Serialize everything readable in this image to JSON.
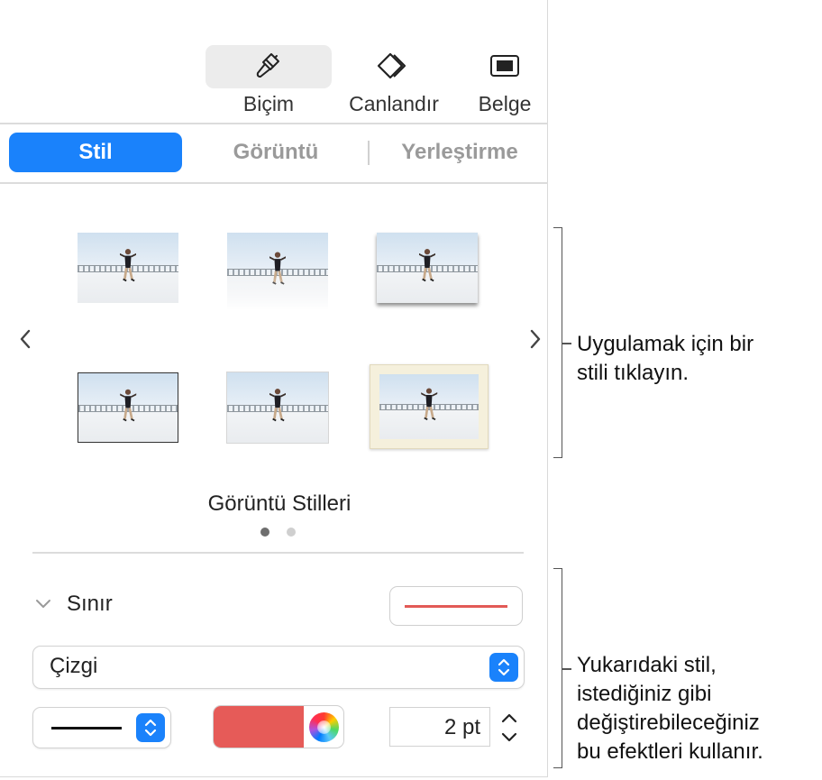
{
  "toolbar": {
    "format_label": "Biçim",
    "animate_label": "Canlandır",
    "document_label": "Belge"
  },
  "tabs": [
    {
      "label": "Stil",
      "active": true
    },
    {
      "label": "Görüntü",
      "active": false
    },
    {
      "label": "Yerleştirme",
      "active": false
    }
  ],
  "styles_section": {
    "title": "Görüntü Stilleri",
    "page_count": 2,
    "current_page": 1
  },
  "border": {
    "label": "Sınır",
    "expanded": true,
    "line_color": "#e25a56",
    "line_type": "Çizgi",
    "fill_color": "#e65b58",
    "width_value": "2 pt"
  },
  "callouts": {
    "top_line1": "Uygulamak için bir",
    "top_line2": "stili tıklayın.",
    "bottom_line1": "Yukarıdaki stil,",
    "bottom_line2": "istediğiniz gibi",
    "bottom_line3": "değiştirebileceğiniz",
    "bottom_line4": "bu efektleri kullanır."
  },
  "colors": {
    "accent": "#1a82fb",
    "border_red": "#e65b58"
  }
}
